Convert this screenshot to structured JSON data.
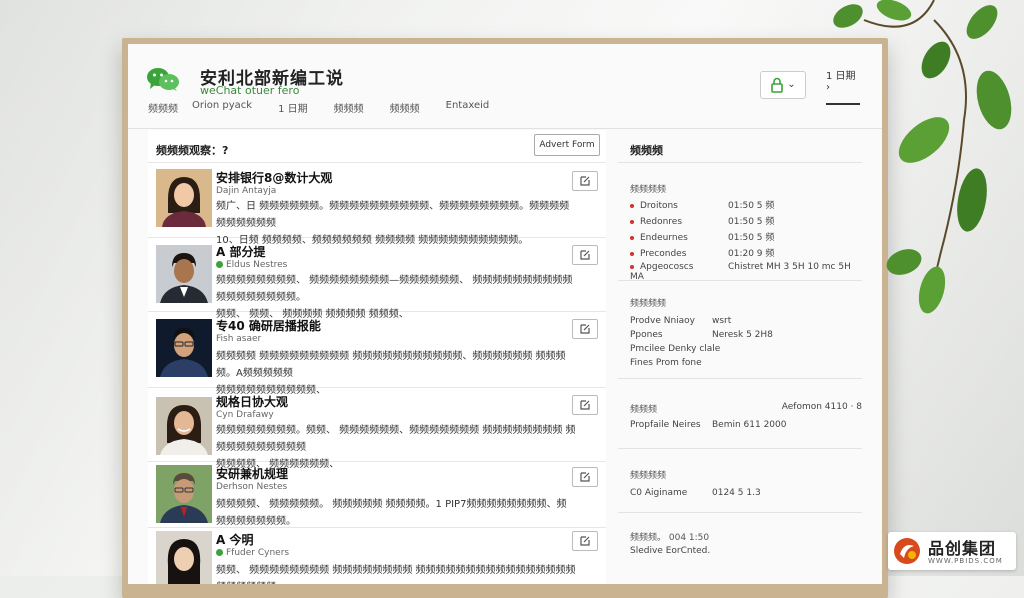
{
  "app": {
    "title": "安利北部新编工说",
    "subtitle": "weChat otuer fero",
    "nav": [
      "频频频",
      "Orion pyack",
      "1 日期",
      "频频频",
      "频频频",
      "Entaxeid"
    ],
    "header_link": "1 日期 ›"
  },
  "list": {
    "heading": "频频频观察：?",
    "advert_button": "Advert Form",
    "rows": [
      {
        "name": "安排银行8@数计大观",
        "sub": "Dajin Antayja",
        "verified": false,
        "lines": [
          "频广、日 频频频频频频。频频频频频频频频频频、频频频频频频频频。频频频频频频频频频频",
          "10、日频 频频频频、频频频频频频 频频频频 频频频频频频频频频频。"
        ]
      },
      {
        "name": "A 部分提",
        "sub": "Eldus Nestres",
        "verified": true,
        "lines": [
          "频频频频频频频频、 频频频频频频频频—频频频频频频、 频频频频频频频频频频频频频频频频频频。",
          "频频、 频频、 频频频频 频频频频 频频频、"
        ]
      },
      {
        "name": "专40 确研居播报能",
        "sub": "Fish asaer",
        "verified": false,
        "lines": [
          "频频频频 频频频频频频频频频 频频频频频频频频频频频、频频频频频频 频频频频。A频频频频频",
          "频频频频频频频频频频、"
        ]
      },
      {
        "name": "规格日协大观",
        "sub": "Cyn Drafawy",
        "verified": false,
        "lines": [
          "频频频频频频频频。频频、 频频频频频频、频频频频频频频 频频频频频频频频 频频频频频频频频频频",
          "频频频频、 频频频频频频、"
        ]
      },
      {
        "name": "安研兼机规理",
        "sub": "Derhson Nestes",
        "verified": false,
        "lines": [
          "频频频频、 频频频频频。 频频频频频 频频频频。1 PIP7频频频频频频频频、频频频频频频频频。"
        ]
      },
      {
        "name": "A 今明",
        "sub": "Ffuder Cyners",
        "verified": true,
        "lines": [
          "频频、 频频频频频频频频 频频频频频频频频 频频频频频频频频频频频频频频频频频频频频频频"
        ]
      }
    ]
  },
  "details": {
    "title": "频频频",
    "section1": {
      "heading": "频频频频",
      "items": [
        {
          "key": "Droitons",
          "value": "01:50 5 频"
        },
        {
          "key": "Redonres",
          "value": "01:50 5 频"
        },
        {
          "key": "Endeurnes",
          "value": "01:50 5 频"
        },
        {
          "key": "Precondes",
          "value": "01:20 9 频"
        },
        {
          "key": "Apgeocoscs",
          "value": "Chistret MH 3 5H 10 mc 5H MA"
        }
      ]
    },
    "section2": {
      "heading": "频频频频",
      "items": [
        {
          "key": "Prodve Nniaoy",
          "value": "wsrt"
        },
        {
          "key": "Ppones",
          "value": "Neresk 5 2H8"
        }
      ],
      "extra": [
        "Pmcilee Denky clale",
        "Fines Prom fone"
      ]
    },
    "section3": {
      "heading": "频频频",
      "heading_value": "Aefomon 4110 · 8",
      "items": [
        {
          "key": "Propfaile Neires",
          "value": "Bemin 611 2000"
        }
      ]
    },
    "section4": {
      "heading": "频频频频",
      "items": [
        {
          "key": "C0 Aiginame",
          "value": "0124 5 1.3"
        }
      ]
    },
    "section5": {
      "heading": "频频频。 004 1:50",
      "extra": [
        "Sledive EorCnted."
      ]
    }
  },
  "watermark": {
    "name": "品创集团",
    "url": "WWW.PBIDS.COM"
  },
  "colors": {
    "accent_green": "#3aa43a",
    "frame_wood": "#c9b391",
    "leaf_green": "#4e8f2e"
  }
}
